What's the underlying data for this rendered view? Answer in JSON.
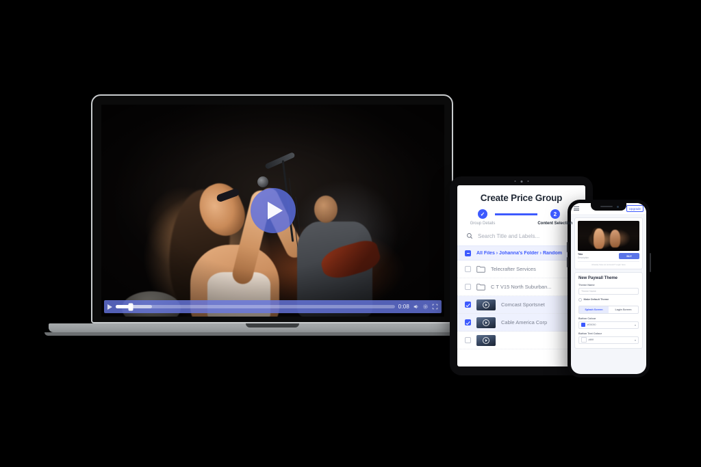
{
  "colors": {
    "accent": "#3d5afe",
    "player_bar": "#6878e2",
    "selected_row": "#eef1fe",
    "laptop_frame": "#c9ccce",
    "laptop_base": "#9a9ea0"
  },
  "laptop": {
    "device_name": "laptop",
    "player": {
      "play_button": "play-icon",
      "small_play_button": "play-icon",
      "current_time": "0:08",
      "volume_icon": "volume-icon",
      "settings_icon": "settings-icon",
      "fullscreen_icon": "fullscreen-icon",
      "progress_percent": 5.5,
      "buffered_percent": 13
    }
  },
  "tablet": {
    "device_name": "tablet",
    "title": "Create Price Group",
    "stepper": [
      {
        "number": "✓",
        "label": "Group Details",
        "state": "done"
      },
      {
        "number": "2",
        "label": "Content Selection",
        "state": "active"
      }
    ],
    "search": {
      "placeholder": "Search Title and Labels...",
      "icon": "search-icon"
    },
    "breadcrumb": "All Files › Johanna's Folder › Random",
    "rows": [
      {
        "name": "Telecrafter Services",
        "type": "folder",
        "checked": false
      },
      {
        "name": "C T V15 North Suburban...",
        "type": "folder",
        "checked": false
      },
      {
        "name": "Comcast Sportsnet",
        "type": "video",
        "checked": true
      },
      {
        "name": "Cable America Corp",
        "type": "video",
        "checked": true
      }
    ]
  },
  "phone": {
    "device_name": "phone",
    "topbar": {
      "menu_icon": "hamburger-menu-icon",
      "bell_icon": "notification-bell-icon",
      "upgrade_label": "Upgrade"
    },
    "preview_card": {
      "title": "Title",
      "description": "Description",
      "buy_label": "BUY",
      "footer": "Already have an account? Login here"
    },
    "form": {
      "title": "New Paywall Theme",
      "theme_name_label": "Theme Name",
      "theme_name_placeholder": "Theme Name",
      "theme_name_value": "",
      "default_theme_label": "Make Default Theme",
      "tabs": [
        {
          "label": "Splash Screen",
          "selected": true
        },
        {
          "label": "Login Screen",
          "selected": false
        }
      ],
      "button_colour_label": "Button Colour",
      "button_colour_value": "#f05050",
      "button_colour_swatch": "#3d5afe",
      "button_text_colour_label": "Button Text Colour",
      "button_text_colour_value": "#ffffff",
      "button_text_colour_swatch": "#ffffff",
      "caret_icon": "chevron-down-icon"
    }
  }
}
